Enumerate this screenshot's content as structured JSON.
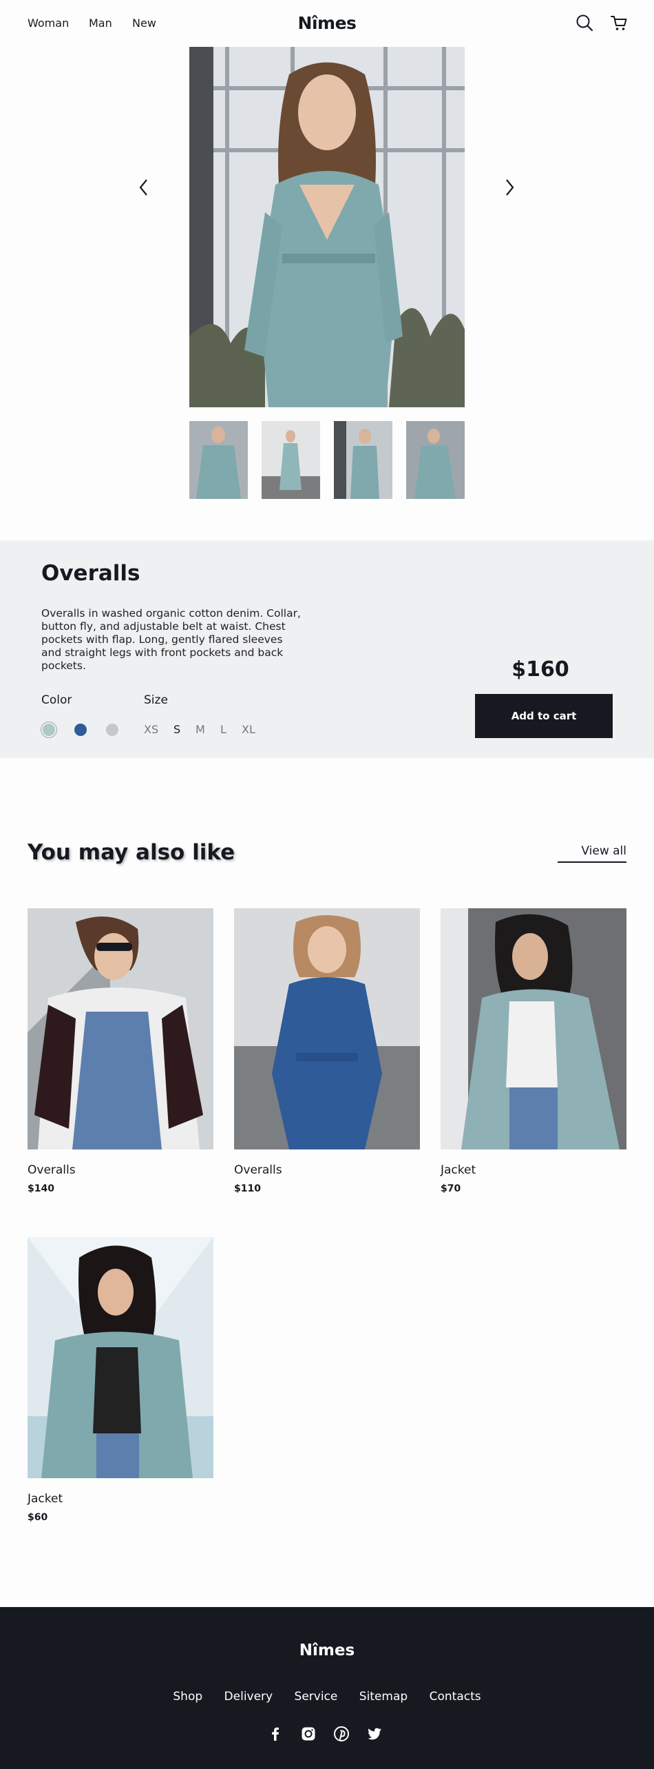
{
  "header": {
    "nav": [
      "Woman",
      "Man",
      "New"
    ],
    "logo": "Nîmes"
  },
  "product": {
    "title": "Overalls",
    "description": "Overalls in washed organic cotton denim. Collar, button fly, and adjustable belt at waist. Chest pockets with flap. Long, gently flared sleeves and straight legs with front pockets and back pockets.",
    "color_label": "Color",
    "size_label": "Size",
    "colors": [
      "#aec8c4",
      "#2f5b98",
      "#c5c7ca"
    ],
    "sizes": [
      "XS",
      "S",
      "M",
      "L",
      "XL"
    ],
    "selected_size": "S",
    "price": "$160",
    "add_to_cart": "Add to cart"
  },
  "recommendations": {
    "title": "You may also like",
    "view_all": "View all",
    "items": [
      {
        "name": "Overalls",
        "price": "$140"
      },
      {
        "name": "Overalls",
        "price": "$110"
      },
      {
        "name": "Jacket",
        "price": "$70"
      },
      {
        "name": "Jacket",
        "price": "$60"
      }
    ]
  },
  "footer": {
    "logo": "Nîmes",
    "links": [
      "Shop",
      "Delivery",
      "Service",
      "Sitemap",
      "Contacts"
    ],
    "social_icons": [
      "facebook-icon",
      "instagram-icon",
      "pinterest-icon",
      "twitter-icon"
    ]
  },
  "colors": {
    "dark": "#161a20",
    "panel": "#eff0f2",
    "denim": "#7fa9ad"
  }
}
